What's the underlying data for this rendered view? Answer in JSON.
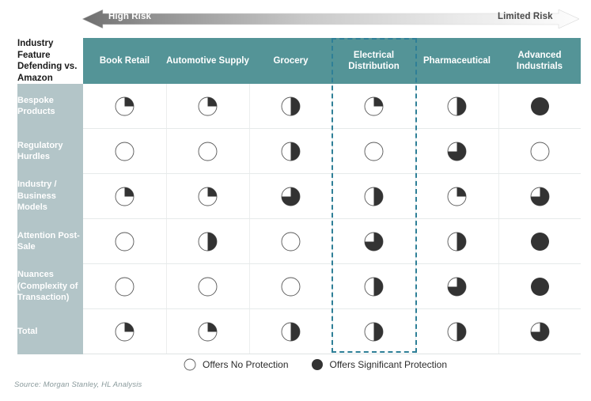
{
  "risk_scale": {
    "left_label": "High Risk",
    "right_label": "Limited Risk",
    "gradient_from": "#6e6e6e",
    "gradient_to": "#ffffff"
  },
  "table": {
    "corner_label": "Industry Feature Defending vs. Amazon",
    "header_bg": "#549497",
    "row_label_bg": "#b3c5c8",
    "highlight_color": "#2e7f97",
    "highlighted_column": "Electrical Distribution",
    "columns": [
      "Book Retail",
      "Automotive Supply",
      "Grocery",
      "Electrical Distribution",
      "Pharmaceutical",
      "Advanced Industrials"
    ],
    "rows": [
      "Bespoke Products",
      "Regulatory Hurdles",
      "Industry / Business Models",
      "Attention Post-Sale",
      "Nuances (Complexity of Transaction)",
      "Total"
    ]
  },
  "chart_data": {
    "type": "heatmap",
    "title": "Industry Feature Defending vs. Amazon",
    "subtitle": "High Risk to Limited Risk",
    "xlabel": "",
    "ylabel": "",
    "value_unit": "percent_protection",
    "scale": [
      0,
      25,
      50,
      75,
      100
    ],
    "scale_meaning": {
      "0": "Offers No Protection",
      "100": "Offers Significant Protection"
    },
    "categories": [
      "Book Retail",
      "Automotive Supply",
      "Grocery",
      "Electrical Distribution",
      "Pharmaceutical",
      "Advanced Industrials"
    ],
    "rows": [
      "Bespoke Products",
      "Regulatory Hurdles",
      "Industry / Business Models",
      "Attention Post-Sale",
      "Nuances (Complexity of Transaction)",
      "Total"
    ],
    "series": [
      {
        "name": "Bespoke Products",
        "values": [
          25,
          25,
          50,
          25,
          50,
          100
        ]
      },
      {
        "name": "Regulatory Hurdles",
        "values": [
          0,
          0,
          50,
          0,
          75,
          0
        ]
      },
      {
        "name": "Industry / Business Models",
        "values": [
          25,
          25,
          75,
          50,
          25,
          75
        ]
      },
      {
        "name": "Attention Post-Sale",
        "values": [
          0,
          50,
          0,
          75,
          50,
          100
        ]
      },
      {
        "name": "Nuances (Complexity of Transaction)",
        "values": [
          0,
          0,
          0,
          50,
          75,
          100
        ]
      },
      {
        "name": "Total",
        "values": [
          25,
          25,
          50,
          50,
          50,
          75
        ]
      }
    ],
    "legend": [
      {
        "label": "Offers No Protection",
        "value": 0
      },
      {
        "label": "Offers Significant Protection",
        "value": 100
      }
    ],
    "legend_position": "bottom",
    "grid": true,
    "annotations": [
      "High Risk",
      "Limited Risk"
    ]
  },
  "legend": {
    "no_protection": "Offers No Protection",
    "significant_protection": "Offers Significant Protection"
  },
  "source": "Source: Morgan Stanley, HL Analysis"
}
